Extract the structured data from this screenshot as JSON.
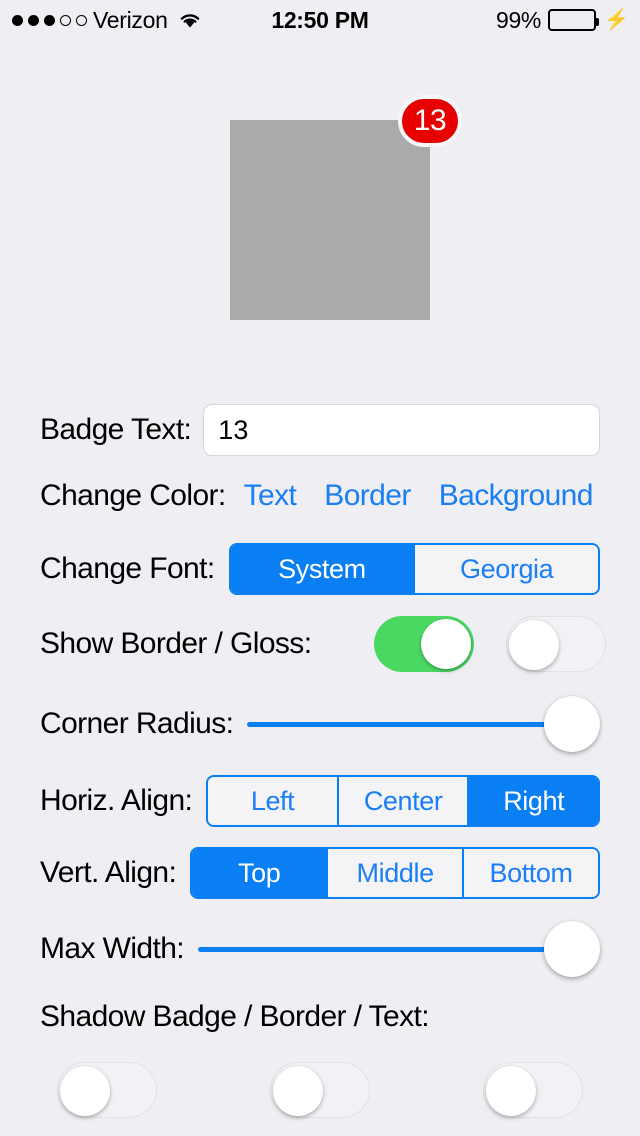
{
  "status_bar": {
    "signal_dots_filled": 3,
    "signal_dots_total": 5,
    "carrier": "Verizon",
    "wifi_icon": "wifi-icon",
    "time": "12:50 PM",
    "battery_percent": "99%",
    "battery_level": 99,
    "charging_icon": "lightning-bolt-icon"
  },
  "preview": {
    "badge_value": "13",
    "badge_background_color": "#e60000",
    "badge_border_color": "#f7f6f8",
    "badge_text_color": "#ffffff",
    "host_view_color": "#aaaaaa"
  },
  "controls": {
    "badge_text": {
      "label": "Badge Text:",
      "value": "13",
      "placeholder": "Badge Text"
    },
    "change_color": {
      "label": "Change Color:",
      "options": [
        "Text",
        "Border",
        "Background"
      ],
      "link_color": "#1a7ef5"
    },
    "change_font": {
      "label": "Change Font:",
      "options": [
        "System",
        "Georgia"
      ],
      "selected": "System"
    },
    "show_border_gloss": {
      "label": "Show Border / Gloss:",
      "border_on": true,
      "gloss_on": false,
      "on_color": "#4ad863"
    },
    "corner_radius": {
      "label": "Corner Radius:",
      "value": 100,
      "min": 0,
      "max": 100,
      "track_color": "#0a7ff3"
    },
    "horiz_align": {
      "label": "Horiz. Align:",
      "options": [
        "Left",
        "Center",
        "Right"
      ],
      "selected": "Right"
    },
    "vert_align": {
      "label": "Vert. Align:",
      "options": [
        "Top",
        "Middle",
        "Bottom"
      ],
      "selected": "Top"
    },
    "max_width": {
      "label": "Max Width:",
      "value": 100,
      "min": 0,
      "max": 100,
      "track_color": "#0a7ff3"
    },
    "shadow": {
      "label": "Shadow Badge / Border / Text:",
      "badge_on": false,
      "border_on": false,
      "text_on": false
    }
  }
}
